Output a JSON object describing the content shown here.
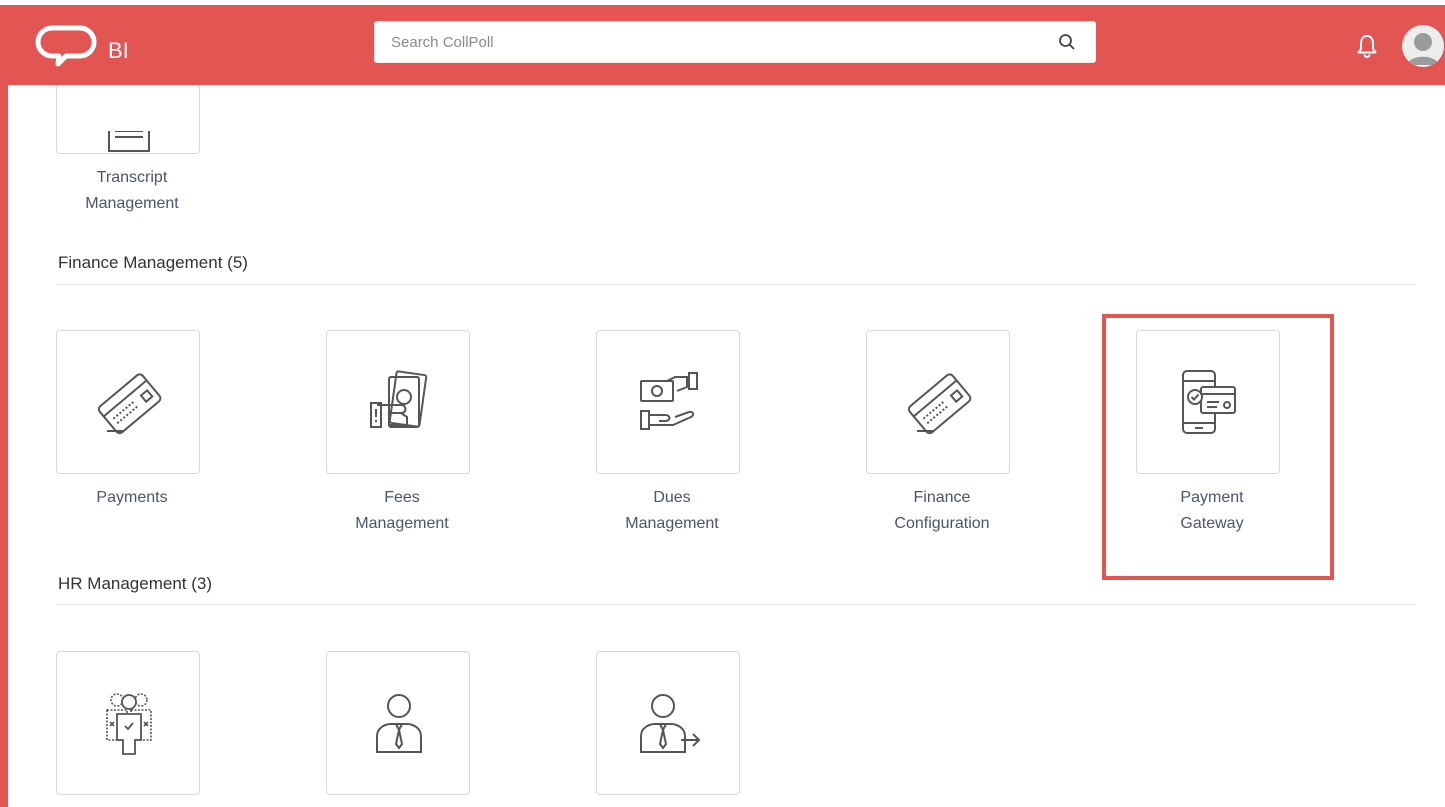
{
  "header": {
    "logo_text": "BI",
    "search_placeholder": "Search CollPoll",
    "accent_color": "#e25553"
  },
  "sections": {
    "top_partial": {
      "tiles": [
        {
          "label_line1": "Transcript",
          "label_line2": "Management",
          "icon": "document-icon"
        }
      ]
    },
    "finance": {
      "title": "Finance Management (5)",
      "tiles": [
        {
          "label_line1": "Payments",
          "label_line2": "",
          "icon": "credit-card-icon"
        },
        {
          "label_line1": "Fees",
          "label_line2": "Management",
          "icon": "cash-hand-icon"
        },
        {
          "label_line1": "Dues",
          "label_line2": "Management",
          "icon": "money-exchange-icon"
        },
        {
          "label_line1": "Finance",
          "label_line2": "Configuration",
          "icon": "credit-card-icon"
        },
        {
          "label_line1": "Payment",
          "label_line2": "Gateway",
          "icon": "mobile-payment-icon"
        }
      ]
    },
    "hr": {
      "title": "HR Management (3)",
      "tiles": [
        {
          "icon": "team-icon"
        },
        {
          "icon": "employee-icon"
        },
        {
          "icon": "employee-exit-icon"
        }
      ]
    }
  }
}
